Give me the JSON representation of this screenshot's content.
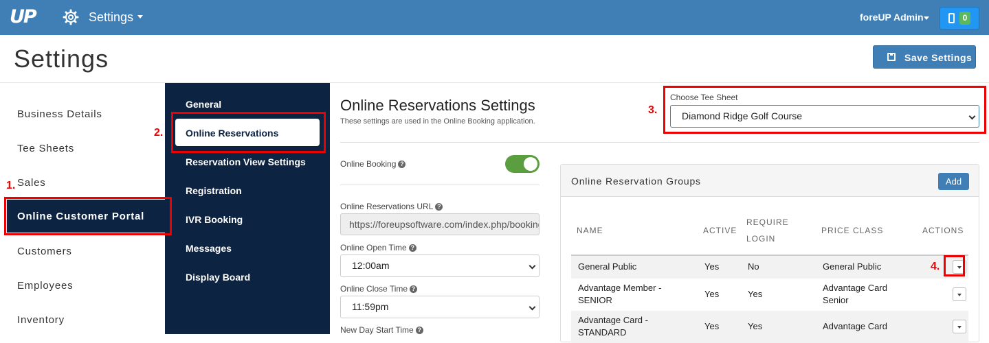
{
  "topbar": {
    "logo": "UP",
    "app_title": "Settings",
    "user_name": "foreUP Admin",
    "notifications_count": "0"
  },
  "page": {
    "title": "Settings",
    "save_label": "Save Settings"
  },
  "left_nav": {
    "items": [
      "Business Details",
      "Tee Sheets",
      "Sales",
      "Online Customer Portal",
      "Customers",
      "Employees",
      "Inventory"
    ],
    "active_index": 3
  },
  "sub_nav": {
    "items": [
      "General",
      "Online Reservations",
      "Reservation View Settings",
      "Registration",
      "IVR Booking",
      "Messages",
      "Display Board"
    ],
    "active_index": 1
  },
  "content": {
    "title": "Online Reservations Settings",
    "subtitle": "These settings are used in the Online Booking application.",
    "tee_sheet_label": "Choose Tee Sheet",
    "tee_sheet_value": "Diamond Ridge Golf Course",
    "online_booking_label": "Online Booking",
    "online_booking_enabled": true,
    "url_label": "Online Reservations URL",
    "url_value": "https://foreupsoftware.com/index.php/booking/",
    "open_time_label": "Online Open Time",
    "open_time_value": "12:00am",
    "close_time_label": "Online Close Time",
    "close_time_value": "11:59pm",
    "new_day_label": "New Day Start Time"
  },
  "groups": {
    "title": "Online Reservation Groups",
    "add_label": "Add",
    "headers": {
      "name": "NAME",
      "active": "ACTIVE",
      "require_1": "REQUIRE",
      "require_2": "LOGIN",
      "price_class": "PRICE CLASS",
      "actions": "ACTIONS"
    },
    "rows": [
      {
        "name_1": "General Public",
        "name_2": "",
        "active": "Yes",
        "require": "No",
        "price_1": "General Public",
        "price_2": ""
      },
      {
        "name_1": "Advantage Member -",
        "name_2": "SENIOR",
        "active": "Yes",
        "require": "Yes",
        "price_1": "Advantage Card",
        "price_2": "Senior"
      },
      {
        "name_1": "Advantage Card -",
        "name_2": "STANDARD",
        "active": "Yes",
        "require": "Yes",
        "price_1": "Advantage Card",
        "price_2": ""
      }
    ]
  },
  "annotations": [
    "1.",
    "2.",
    "3.",
    "4."
  ],
  "colors": {
    "topbar": "#3f7fb6",
    "nav_dark": "#0c2341",
    "toggle_on": "#5a9e3f",
    "annotation": "#ee0000"
  }
}
